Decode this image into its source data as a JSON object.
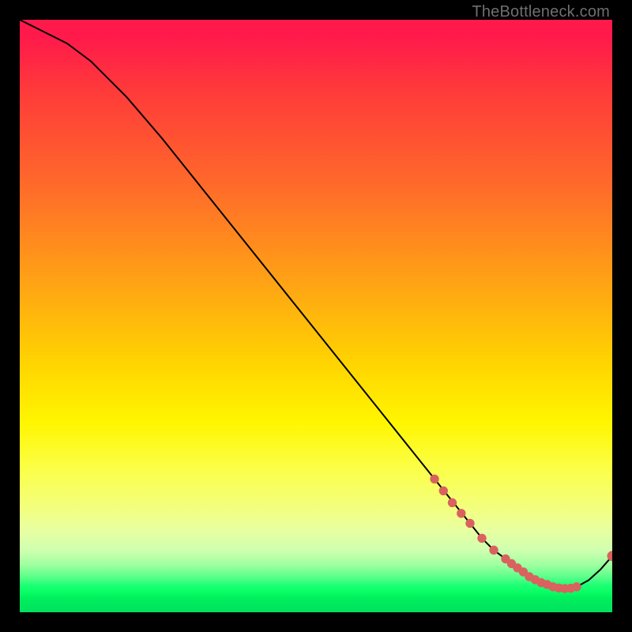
{
  "watermark": "TheBottleneck.com",
  "colors": {
    "background": "#000000",
    "curve": "#000000",
    "points": "#d9625f"
  },
  "chart_data": {
    "type": "line",
    "title": "",
    "xlabel": "",
    "ylabel": "",
    "xlim": [
      0,
      100
    ],
    "ylim": [
      0,
      100
    ],
    "grid": false,
    "legend": false,
    "background": "red-to-green vertical gradient (bottleneck heatmap)",
    "series": [
      {
        "name": "bottleneck-curve",
        "x": [
          0,
          4,
          8,
          12,
          18,
          24,
          30,
          36,
          42,
          48,
          54,
          60,
          66,
          70,
          74,
          76,
          78,
          80,
          82,
          84,
          86,
          88,
          90,
          92,
          94,
          96,
          98,
          100
        ],
        "y": [
          100,
          98,
          96,
          93,
          87,
          80,
          72.5,
          65,
          57.5,
          50,
          42.5,
          35,
          27.5,
          22.5,
          17.5,
          15,
          12.5,
          10.5,
          9,
          7.5,
          6,
          5,
          4.3,
          4,
          4.3,
          5.4,
          7.2,
          9.5
        ]
      }
    ],
    "scatter_points": {
      "name": "highlighted-points",
      "x": [
        70,
        71.5,
        73,
        74.5,
        76,
        78,
        80,
        82,
        83,
        84,
        85,
        86,
        87,
        88,
        89,
        90,
        91,
        92,
        93,
        94,
        100
      ],
      "y": [
        22.5,
        20.5,
        18.5,
        16.7,
        15,
        12.5,
        10.5,
        9,
        8.2,
        7.5,
        6.8,
        6,
        5.5,
        5,
        4.7,
        4.3,
        4.1,
        4,
        4.05,
        4.3,
        9.5
      ]
    }
  }
}
